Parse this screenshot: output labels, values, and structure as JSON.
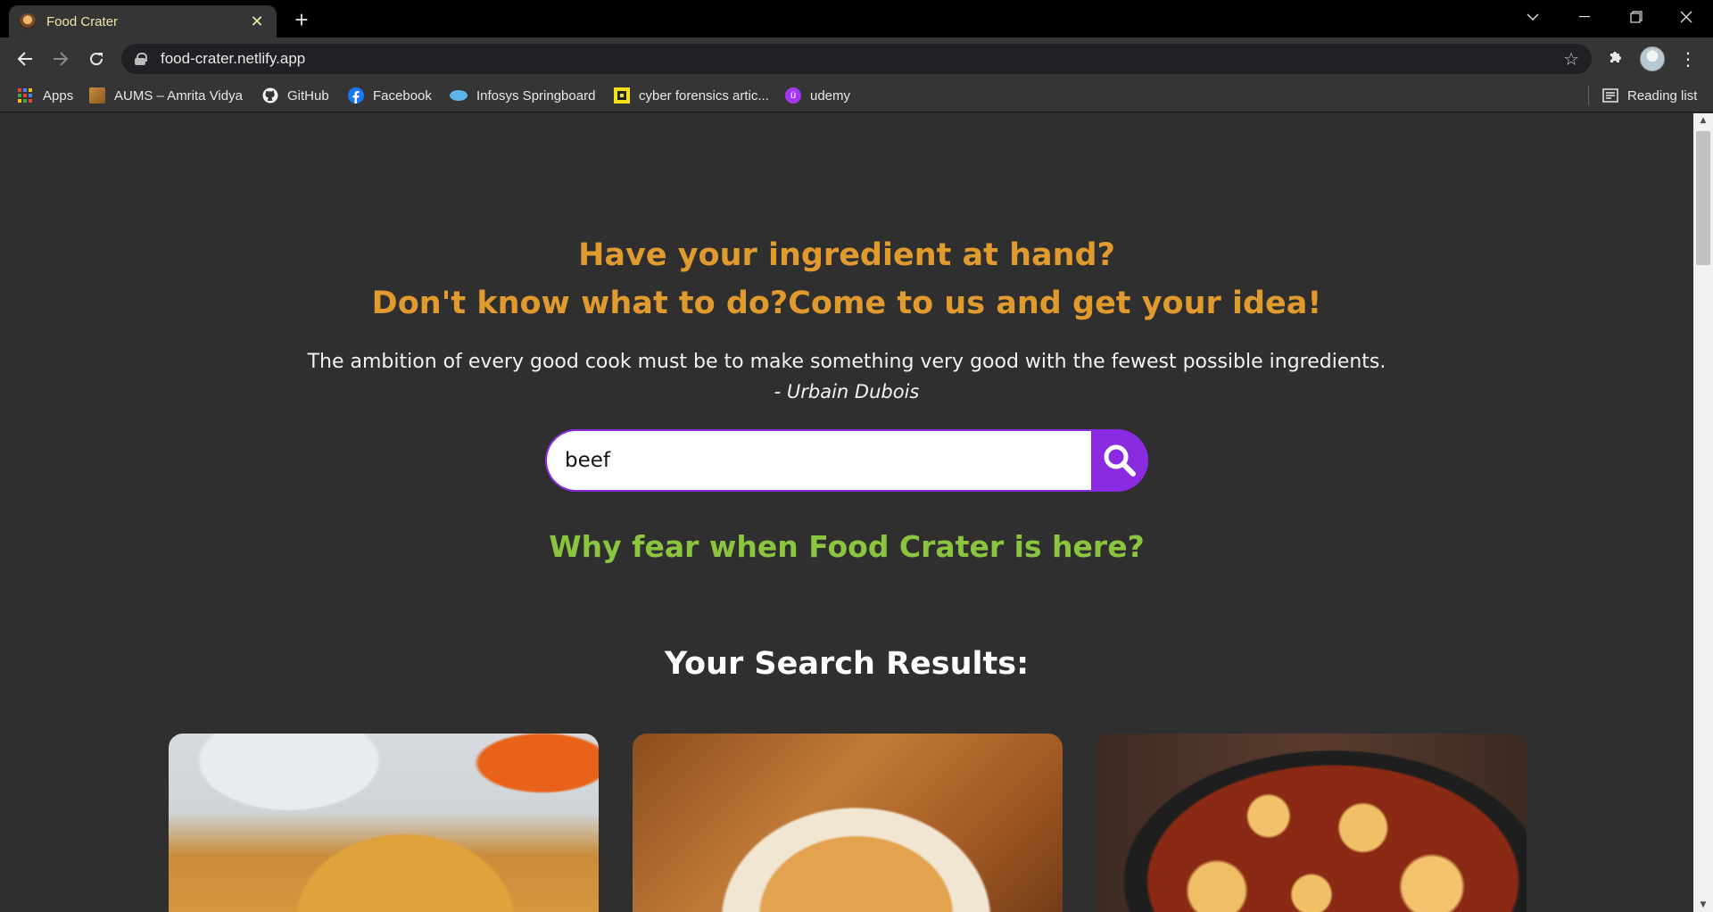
{
  "browser": {
    "tab_title": "Food Crater",
    "tab_close": "✕",
    "new_tab": "+",
    "url": "food-crater.netlify.app",
    "bookmarks": [
      {
        "label": "Apps",
        "icon": "apps-grid-icon"
      },
      {
        "label": "AUMS – Amrita Vidya",
        "icon": "aums-icon"
      },
      {
        "label": "GitHub",
        "icon": "github-icon"
      },
      {
        "label": "Facebook",
        "icon": "facebook-icon"
      },
      {
        "label": "Infosys Springboard",
        "icon": "infosys-icon"
      },
      {
        "label": "cyber forensics artic...",
        "icon": "cyber-forensics-icon"
      },
      {
        "label": "udemy",
        "icon": "udemy-icon"
      }
    ],
    "reading_list": "Reading list"
  },
  "page": {
    "headline_line1": "Have your ingredient at hand?",
    "headline_line2": "Don't know what to do?Come to us and get your idea!",
    "quote": "The ambition of every good cook must be to make something very good with the fewest possible ingredients.",
    "author": "- Urbain Dubois",
    "search": {
      "value": "beef",
      "button_icon": "search-icon"
    },
    "tagline": "Why fear when Food Crater is here?",
    "results_title": "Your Search Results:",
    "result_cards": [
      {
        "image": "chicken-pie-photo"
      },
      {
        "image": "beef-pie-photo"
      },
      {
        "image": "beef-stew-dumplings-photo"
      }
    ]
  },
  "colors": {
    "page_background": "#2f2f2f",
    "headline": "#e09a2e",
    "tagline": "#8bc53f",
    "search_accent": "#8a2be2"
  }
}
